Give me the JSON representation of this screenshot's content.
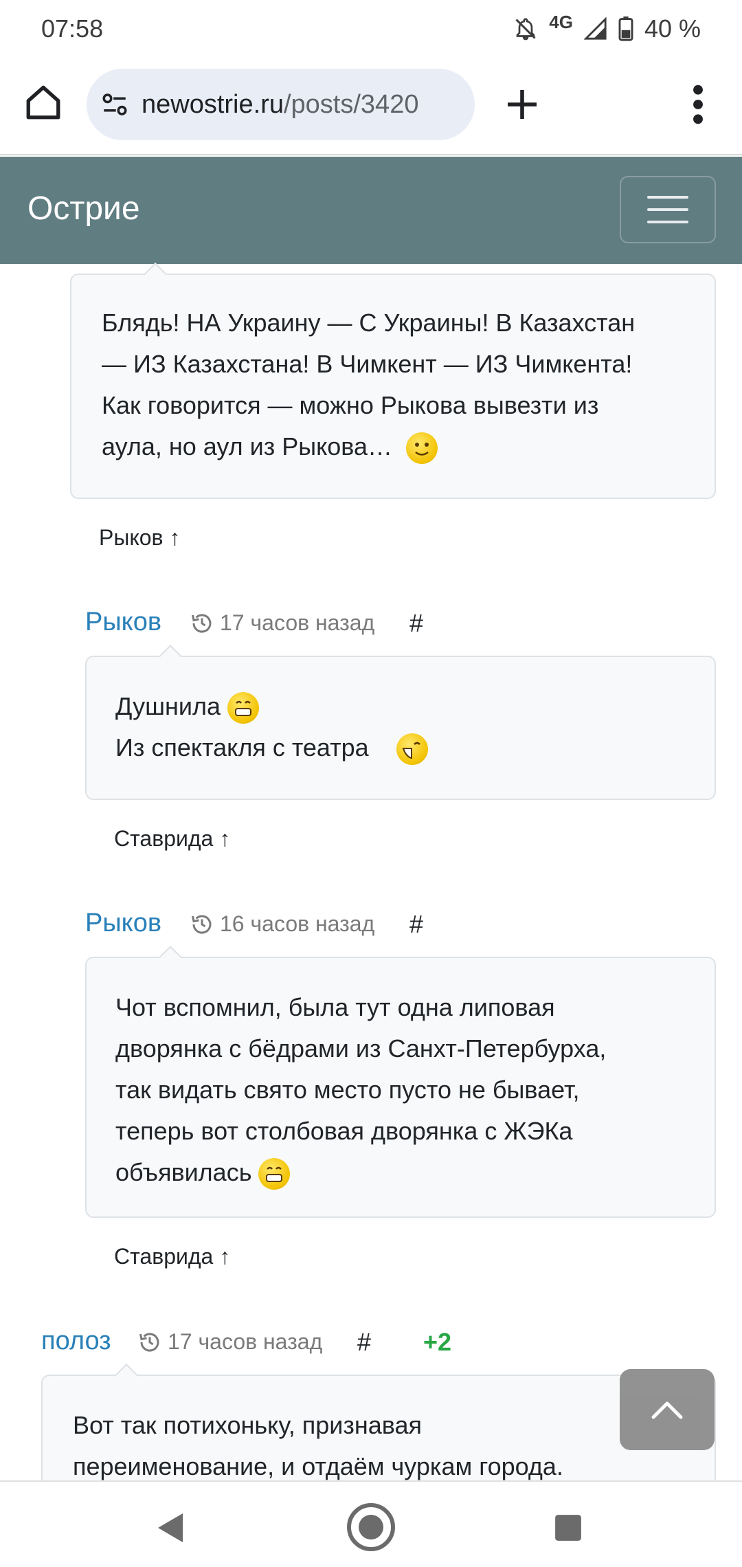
{
  "status": {
    "time": "07:58",
    "network": "4G",
    "battery": "40 %"
  },
  "browser": {
    "url_domain": "newostrie.ru",
    "url_path": "/posts/3420",
    "home_icon": "home-icon",
    "tab_icon": "site-settings-icon",
    "new_tab_icon": "plus-icon",
    "menu_icon": "more-vert-icon"
  },
  "site": {
    "brand": "Острие",
    "navbar_color": "#607d82"
  },
  "comments": [
    {
      "text": "Блядь! НА Украину — С Украины! В Казахстан\n— ИЗ Казахстана! В Чимкент — ИЗ Чимкента!\nКак говорится — можно Рыкова вывезти из\nаула, но аул из Рыкова…",
      "reply_to": "Рыков ↑"
    },
    {
      "author": "Рыков",
      "time": "17 часов назад",
      "anchor": "#",
      "line1": "Душнила",
      "line2": "Из спектакля с театра",
      "reply_to": "Ставрида ↑"
    },
    {
      "author": "Рыков",
      "time": "16 часов назад",
      "anchor": "#",
      "text": "Чот вспомнил, была тут одна липовая\nдворянка с бёдрами из Санхт-Петербурха,\nтак видать свято место пусто не бывает,\nтеперь вот столбовая дворянка с ЖЭКа\nобъявилась",
      "reply_to": "Ставрида ↑"
    },
    {
      "author": "полоз",
      "time": "17 часов назад",
      "anchor": "#",
      "score": "+2",
      "text": "Вот так потихоньку, признавая\nпереименование, и отдаём чуркам города."
    }
  ],
  "colors": {
    "author": "#2980b9",
    "score": "#28a745",
    "comment_bg": "#f8f9fa"
  }
}
